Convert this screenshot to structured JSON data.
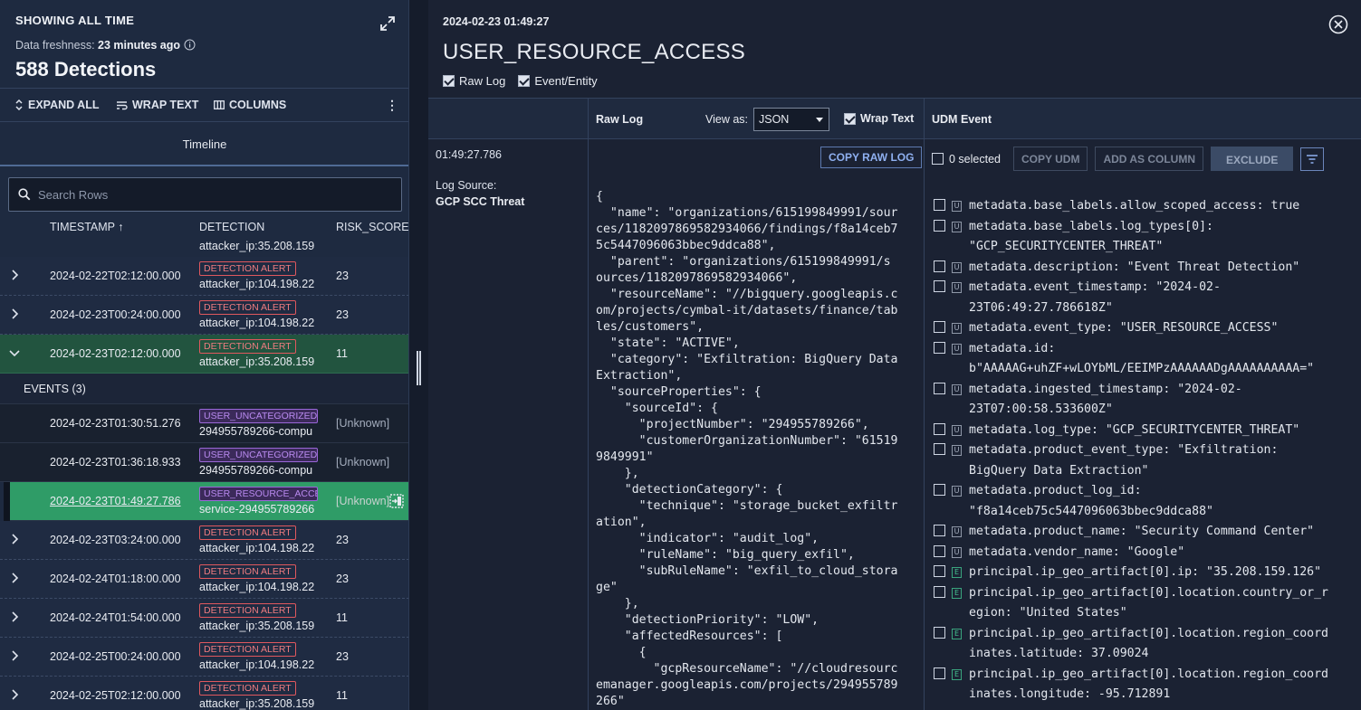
{
  "left": {
    "header": {
      "title": "SHOWING ALL TIME",
      "freshness_label": "Data freshness:",
      "freshness_value": "23 minutes ago",
      "count": "588 Detections"
    },
    "toolbar": {
      "expand_all": "EXPAND ALL",
      "wrap_text": "WRAP TEXT",
      "columns": "COLUMNS"
    },
    "timeline_tab": "Timeline",
    "search": {
      "placeholder": "Search Rows"
    },
    "columns": {
      "timestamp": "TIMESTAMP ↑",
      "detection": "DETECTION",
      "risk": "RISK_SCORE ("
    },
    "partial_top": "attacker_ip:35.208.159",
    "rows": [
      {
        "ts": "2024-02-22T02:12:00.000",
        "badge": "DETECTION ALERT",
        "sub": "attacker_ip:104.198.22",
        "risk": "23"
      },
      {
        "ts": "2024-02-23T00:24:00.000",
        "badge": "DETECTION ALERT",
        "sub": "attacker_ip:104.198.22",
        "risk": "23"
      },
      {
        "ts": "2024-02-23T02:12:00.000",
        "badge": "DETECTION ALERT",
        "sub": "attacker_ip:35.208.159",
        "risk": "11"
      }
    ],
    "events_label": "EVENTS (3)",
    "events": [
      {
        "ts": "2024-02-23T01:30:51.276",
        "badge": "USER_UNCATEGORIZED",
        "sub": "294955789266-compu",
        "risk": "[Unknown]"
      },
      {
        "ts": "2024-02-23T01:36:18.933",
        "badge": "USER_UNCATEGORIZED",
        "sub": "294955789266-compu",
        "risk": "[Unknown]"
      },
      {
        "ts": "2024-02-23T01:49:27.786",
        "badge": "USER_RESOURCE_ACCES",
        "sub": "service-294955789266",
        "risk": "[Unknown]"
      }
    ],
    "rows2": [
      {
        "ts": "2024-02-23T03:24:00.000",
        "badge": "DETECTION ALERT",
        "sub": "attacker_ip:104.198.22",
        "risk": "23"
      },
      {
        "ts": "2024-02-24T01:18:00.000",
        "badge": "DETECTION ALERT",
        "sub": "attacker_ip:104.198.22",
        "risk": "23"
      },
      {
        "ts": "2024-02-24T01:54:00.000",
        "badge": "DETECTION ALERT",
        "sub": "attacker_ip:35.208.159",
        "risk": "11"
      },
      {
        "ts": "2024-02-25T00:24:00.000",
        "badge": "DETECTION ALERT",
        "sub": "attacker_ip:104.198.22",
        "risk": "23"
      },
      {
        "ts": "2024-02-25T02:12:00.000",
        "badge": "DETECTION ALERT",
        "sub": "attacker_ip:35.208.159",
        "risk": "11"
      }
    ]
  },
  "right": {
    "date": "2024-02-23 01:49:27",
    "title": "USER_RESOURCE_ACCESS",
    "check_raw": "Raw Log",
    "check_event": "Event/Entity",
    "raw_head": "Raw Log",
    "view_as_label": "View as:",
    "view_as_value": "JSON",
    "wrap_text": "Wrap Text",
    "udm_head": "UDM Event",
    "time": "01:49:27.786",
    "log_source_label": "Log Source:",
    "log_source_value": "GCP SCC Threat",
    "copy_raw": "COPY RAW LOG",
    "raw_lines": [
      "{",
      "  \"name\": \"organizations/615199849991/sour",
      "ces/1182097869582934066/findings/f8a14ceb7",
      "5c5447096063bbec9ddca88\",",
      "  \"parent\": \"organizations/615199849991/s",
      "ources/1182097869582934066\",",
      "  \"resourceName\": \"//bigquery.googleapis.c",
      "om/projects/cymbal-it/datasets/finance/tab",
      "les/customers\",",
      "  \"state\": \"ACTIVE\",",
      "  \"category\": \"Exfiltration: BigQuery Data",
      "Extraction\",",
      "  \"sourceProperties\": {",
      "    \"sourceId\": {",
      "      \"projectNumber\": \"294955789266\",",
      "      \"customerOrganizationNumber\": \"61519",
      "9849991\"",
      "    },",
      "    \"detectionCategory\": {",
      "      \"technique\": \"storage_bucket_exfiltr",
      "ation\",",
      "      \"indicator\": \"audit_log\",",
      "      \"ruleName\": \"big_query_exfil\",",
      "      \"subRuleName\": \"exfil_to_cloud_stora",
      "ge\"",
      "    },",
      "    \"detectionPriority\": \"LOW\",",
      "    \"affectedResources\": [",
      "      {",
      "        \"gcpResourceName\": \"//cloudresourc",
      "emanager.googleapis.com/projects/294955789",
      "266\""
    ],
    "udm": {
      "selected": "0 selected",
      "copy_udm": "COPY UDM",
      "add_column": "ADD AS COLUMN",
      "exclude": "EXCLUDE",
      "items": [
        {
          "tag": "U",
          "lines": [
            "metadata.base_labels.allow_scoped_access: true"
          ]
        },
        {
          "tag": "U",
          "lines": [
            "metadata.base_labels.log_types[0]:",
            "\"GCP_SECURITYCENTER_THREAT\""
          ]
        },
        {
          "tag": "U",
          "lines": [
            "metadata.description: \"Event Threat Detection\""
          ]
        },
        {
          "tag": "U",
          "lines": [
            "metadata.event_timestamp: \"2024-02-",
            "23T06:49:27.786618Z\""
          ]
        },
        {
          "tag": "U",
          "lines": [
            "metadata.event_type: \"USER_RESOURCE_ACCESS\""
          ]
        },
        {
          "tag": "U",
          "lines": [
            "metadata.id:",
            "b\"AAAAAG+uhZF+wLOYbML/EEIMPzAAAAAADgAAAAAAAAAA=\""
          ]
        },
        {
          "tag": "U",
          "lines": [
            "metadata.ingested_timestamp: \"2024-02-",
            "23T07:00:58.533600Z\""
          ]
        },
        {
          "tag": "U",
          "lines": [
            "metadata.log_type: \"GCP_SECURITYCENTER_THREAT\""
          ]
        },
        {
          "tag": "U",
          "lines": [
            "metadata.product_event_type: \"Exfiltration:",
            "BigQuery Data Extraction\""
          ]
        },
        {
          "tag": "U",
          "lines": [
            "metadata.product_log_id:",
            "\"f8a14ceb75c5447096063bbec9ddca88\""
          ]
        },
        {
          "tag": "U",
          "lines": [
            "metadata.product_name: \"Security Command Center\""
          ]
        },
        {
          "tag": "U",
          "lines": [
            "metadata.vendor_name: \"Google\""
          ]
        },
        {
          "tag": "E",
          "lines": [
            "principal.ip_geo_artifact[0].ip: \"35.208.159.126\""
          ]
        },
        {
          "tag": "E",
          "lines": [
            "principal.ip_geo_artifact[0].location.country_or_r",
            "egion: \"United States\""
          ]
        },
        {
          "tag": "E",
          "lines": [
            "principal.ip_geo_artifact[0].location.region_coord",
            "inates.latitude: 37.09024"
          ]
        },
        {
          "tag": "E",
          "lines": [
            "principal.ip_geo_artifact[0].location.region_coord",
            "inates.longitude: -95.712891"
          ]
        }
      ]
    }
  }
}
